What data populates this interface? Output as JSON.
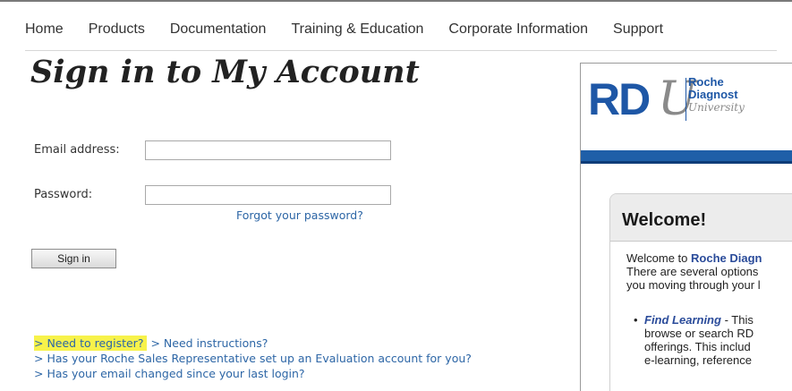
{
  "nav": {
    "items": [
      "Home",
      "Products",
      "Documentation",
      "Training & Education",
      "Corporate Information",
      "Support"
    ]
  },
  "page_title": "Sign in to My Account",
  "form": {
    "email_label": "Email address:",
    "email_value": "",
    "password_label": "Password:",
    "password_value": "",
    "forgot_link": "Forgot your password?",
    "signin_button": "Sign in"
  },
  "help_links": {
    "register": "> Need to register?",
    "instructions": "> Need instructions?",
    "evaluation": "> Has your Roche Sales Representative set up an Evaluation account for you?",
    "email_changed": "> Has your email changed since your last login?"
  },
  "overlay": {
    "logo_mark": "RD",
    "logo_u": "U",
    "logo_line1": "Roche",
    "logo_line2": "Diagnost",
    "logo_line3": "University",
    "welcome_title": "Welcome!",
    "welcome_prefix": "Welcome to ",
    "welcome_brand": "Roche Diagn",
    "welcome_line2": "There are several options",
    "welcome_line3": "you moving through your l",
    "bullet_term": "Find Learning",
    "bullet_line1_rest": " - This",
    "bullet_line2": "browse or search RD",
    "bullet_line3": "offerings.  This includ",
    "bullet_line4": "e-learning, reference"
  },
  "colors": {
    "link": "#2d66a6",
    "highlight": "#f7f24a",
    "brand_blue": "#1e57a6"
  }
}
